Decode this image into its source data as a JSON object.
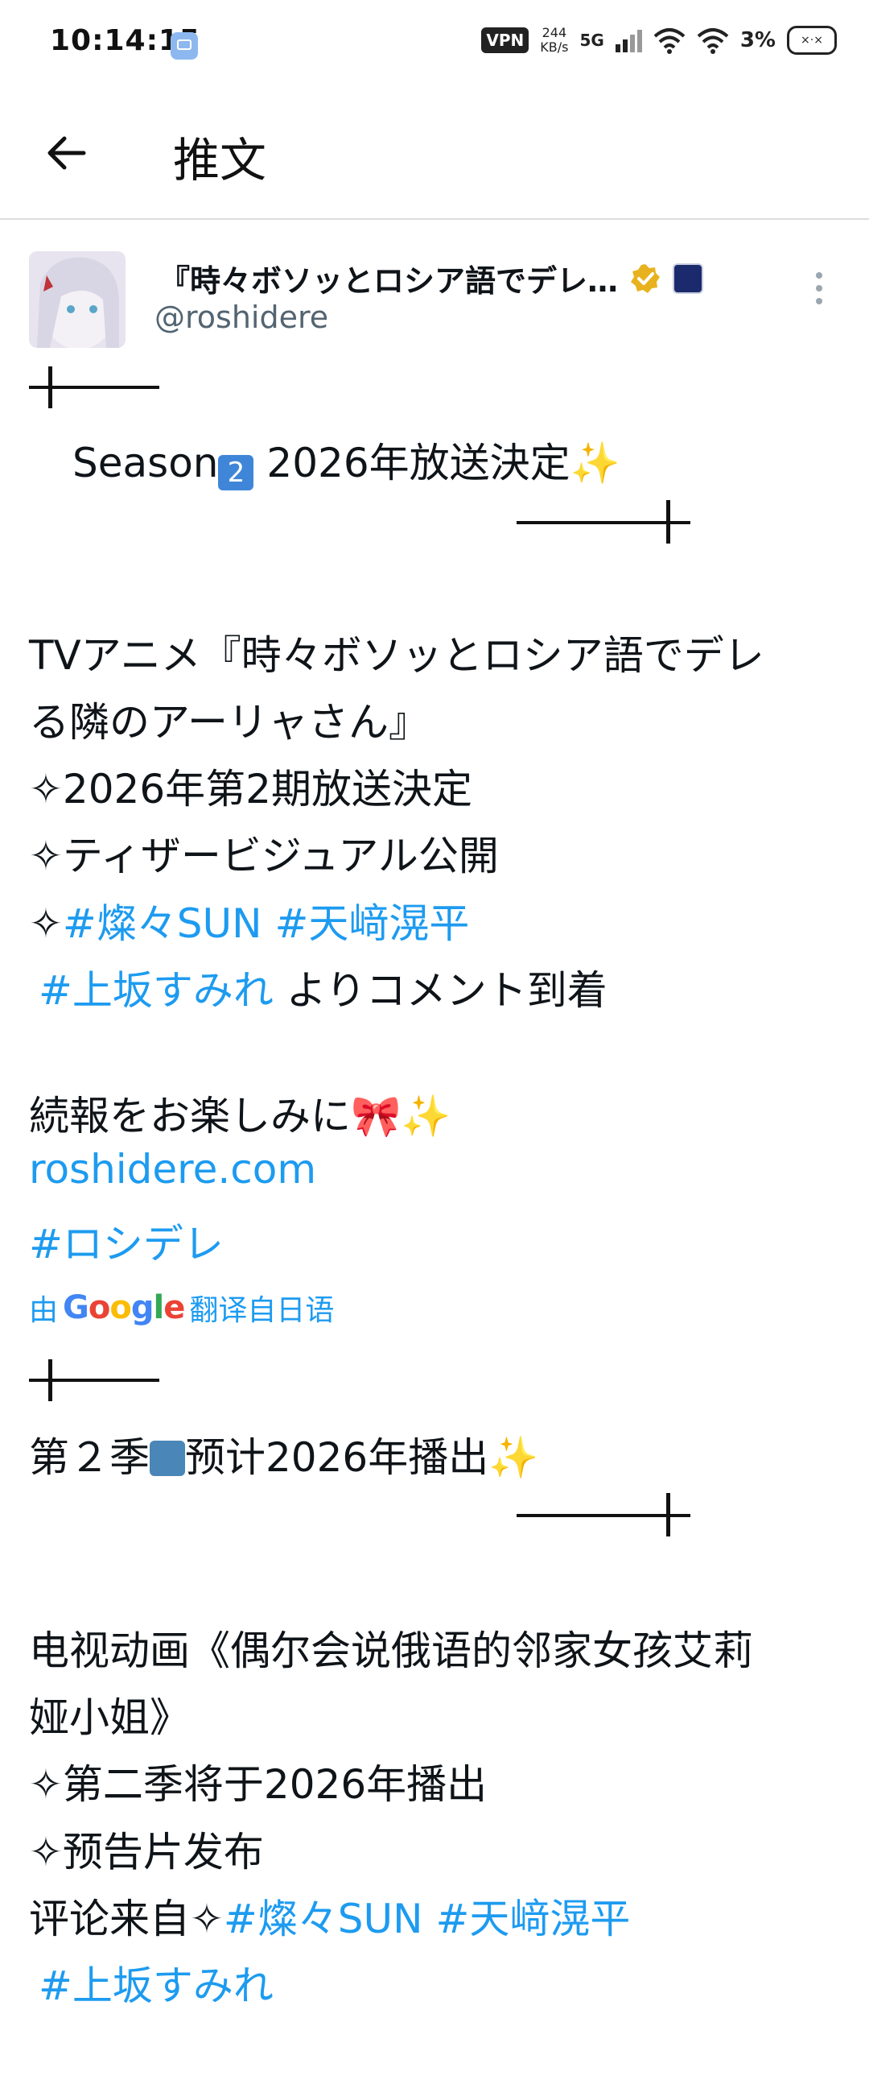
{
  "status_bar": {
    "time": "10:14:15",
    "vpn": "VPN",
    "speed_value": "244",
    "speed_unit": "KB/s",
    "network": "5G",
    "battery_percent": "3%",
    "battery_glyph": "×·×"
  },
  "app_bar": {
    "title": "推文"
  },
  "tweet": {
    "display_name": "『時々ボソッとロシア語でデレ…",
    "handle": "@roshidere",
    "original": {
      "season_line": "Season",
      "season_num": "2",
      "season_rest": " 2026年放送決定",
      "line1": "TVアニメ『時々ボソッとロシア語でデレ",
      "line2": "る隣のアーリャさん』",
      "line3": "✧2026年第2期放送決定",
      "line4": "✧ティザービジュアル公開",
      "line5_prefix": "✧",
      "tag1": "#燦々SUN",
      "tag2": "#天﨑滉平",
      "tag3": "#上坂すみれ",
      "line6_suffix": " よりコメント到着",
      "line7": "続報をお楽しみに",
      "link": "roshidere.com",
      "tag4": "#ロシデレ"
    },
    "translate_prefix": "由",
    "translate_brand": "Google",
    "translate_suffix": "翻译自日语",
    "translated": {
      "season_line_a": "第２季",
      "season_line_b": "预计2026年播出",
      "line1": "电视动画《偶尔会说俄语的邻家女孩艾莉",
      "line2": "娅小姐》",
      "line3": "✧第二季将于2026年播出",
      "line4": "✧预告片发布",
      "line5_prefix": "评论来自✧",
      "tag1": "#燦々SUN",
      "tag2": "#天﨑滉平",
      "tag3": "#上坂すみれ"
    }
  },
  "colors": {
    "link": "#1d9bf0",
    "text": "#0f1419",
    "handle": "#536471",
    "verified": "#e8b21f"
  }
}
